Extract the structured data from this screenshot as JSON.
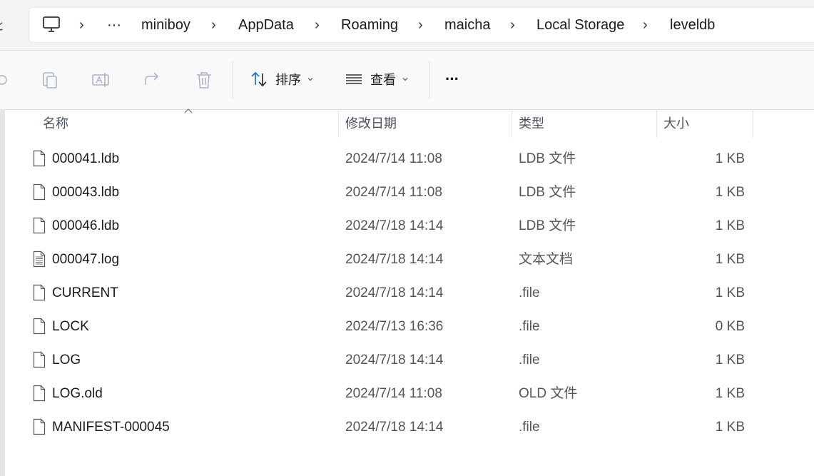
{
  "window": {
    "left_edge_glyph": "ﾋ"
  },
  "breadcrumb": {
    "overflow": "···",
    "items": [
      "miniboy",
      "AppData",
      "Roaming",
      "maicha",
      "Local Storage",
      "leveldb"
    ],
    "separator": "›"
  },
  "toolbar": {
    "sort_label": "排序",
    "view_label": "查看",
    "more_label": "···",
    "chevron": "⌄"
  },
  "columns": {
    "name": "名称",
    "date": "修改日期",
    "type": "类型",
    "size": "大小"
  },
  "files": [
    {
      "name": "000041.ldb",
      "date": "2024/7/14 11:08",
      "type": "LDB 文件",
      "size": "1 KB",
      "icon": "document-icon"
    },
    {
      "name": "000043.ldb",
      "date": "2024/7/14 11:08",
      "type": "LDB 文件",
      "size": "1 KB",
      "icon": "document-icon"
    },
    {
      "name": "000046.ldb",
      "date": "2024/7/18 14:14",
      "type": "LDB 文件",
      "size": "1 KB",
      "icon": "document-icon"
    },
    {
      "name": "000047.log",
      "date": "2024/7/18 14:14",
      "type": "文本文档",
      "size": "1 KB",
      "icon": "text-document-icon"
    },
    {
      "name": "CURRENT",
      "date": "2024/7/18 14:14",
      "type": ".file",
      "size": "1 KB",
      "icon": "document-icon"
    },
    {
      "name": "LOCK",
      "date": "2024/7/13 16:36",
      "type": ".file",
      "size": "0 KB",
      "icon": "document-icon"
    },
    {
      "name": "LOG",
      "date": "2024/7/18 14:14",
      "type": ".file",
      "size": "1 KB",
      "icon": "document-icon"
    },
    {
      "name": "LOG.old",
      "date": "2024/7/14 11:08",
      "type": "OLD 文件",
      "size": "1 KB",
      "icon": "document-icon"
    },
    {
      "name": "MANIFEST-000045",
      "date": "2024/7/18 14:14",
      "type": ".file",
      "size": "1 KB",
      "icon": "document-icon"
    }
  ],
  "colors": {
    "accent": "#1a73c7",
    "toolbar_icon_disabled": "#a9b6c6"
  }
}
